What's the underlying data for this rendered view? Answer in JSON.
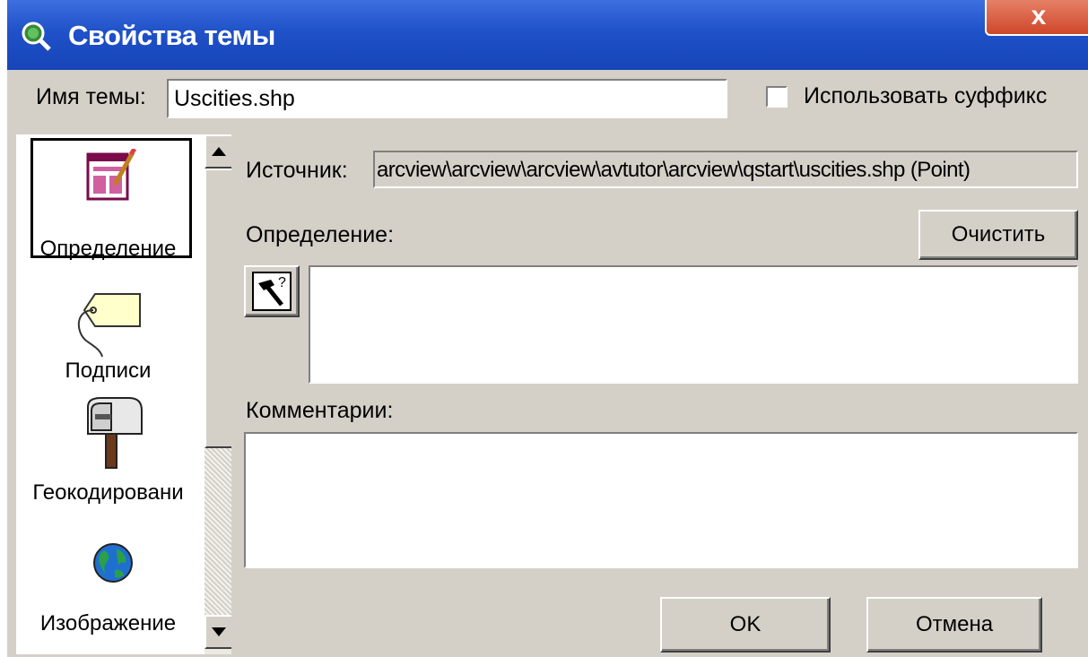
{
  "window": {
    "title": "Свойства темы",
    "close_label": "x"
  },
  "theme_name": {
    "label": "Имя темы:",
    "value": "Uscities.shp"
  },
  "use_suffix": {
    "label": "Использовать суффикс",
    "checked": false
  },
  "sidebar": {
    "items": [
      {
        "label": "Определение",
        "icon": "definition-form-icon",
        "selected": true
      },
      {
        "label": "Подписи",
        "icon": "label-tag-icon",
        "selected": false
      },
      {
        "label": "Геокодировани",
        "icon": "mailbox-icon",
        "selected": false
      },
      {
        "label": "Изображение",
        "icon": "globe-icon",
        "selected": false
      }
    ]
  },
  "source": {
    "label": "Источник:",
    "value": "arcview\\arcview\\arcview\\avtutor\\arcview\\qstart\\uscities.shp (Point)"
  },
  "definition": {
    "label": "Определение:",
    "clear_button": "Очистить",
    "value": ""
  },
  "comments": {
    "label": "Комментарии:",
    "value": ""
  },
  "footer": {
    "ok_button": "OK",
    "cancel_button": "Отмена"
  },
  "colors": {
    "titlebar": "#1f51c8",
    "face": "#d4d0c8"
  }
}
